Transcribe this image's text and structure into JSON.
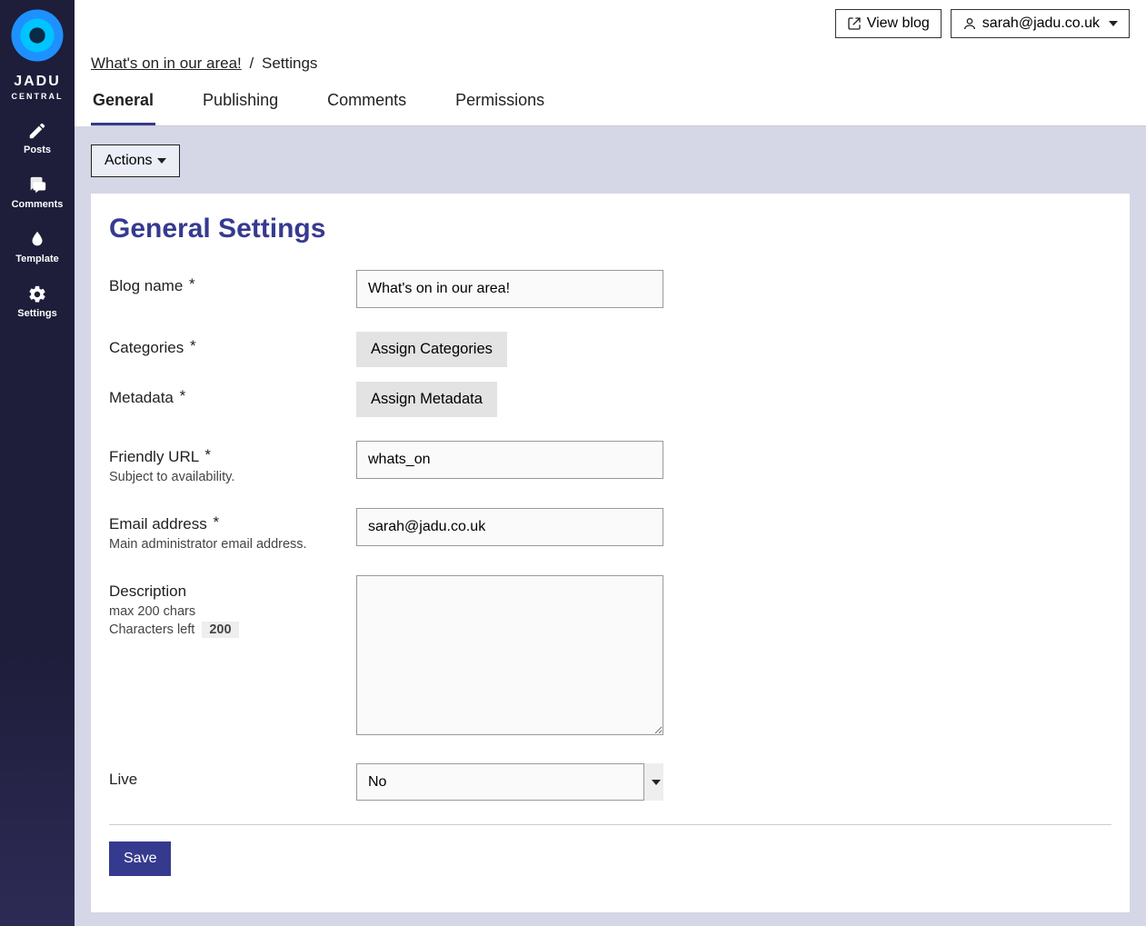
{
  "brand": {
    "main": "JADU",
    "sub": "CENTRAL"
  },
  "sidebar": {
    "items": [
      {
        "label": "Posts"
      },
      {
        "label": "Comments"
      },
      {
        "label": "Template"
      },
      {
        "label": "Settings"
      }
    ]
  },
  "topbar": {
    "view_blog": "View blog",
    "user_email": "sarah@jadu.co.uk"
  },
  "breadcrumb": {
    "link": "What's on in our area!",
    "sep": "/",
    "current": "Settings"
  },
  "tabs": [
    {
      "label": "General",
      "active": true
    },
    {
      "label": "Publishing"
    },
    {
      "label": "Comments"
    },
    {
      "label": "Permissions"
    }
  ],
  "actions_label": "Actions",
  "panel_title": "General Settings",
  "form": {
    "blog_name": {
      "label": "Blog name",
      "value": "What's on in our area!"
    },
    "categories": {
      "label": "Categories",
      "button": "Assign Categories"
    },
    "metadata": {
      "label": "Metadata",
      "button": "Assign Metadata"
    },
    "friendly_url": {
      "label": "Friendly URL",
      "help": "Subject to availability.",
      "value": "whats_on"
    },
    "email": {
      "label": "Email address",
      "help": "Main administrator email address.",
      "value": "sarah@jadu.co.uk"
    },
    "description": {
      "label": "Description",
      "help1": "max 200 chars",
      "help2_prefix": "Characters left",
      "chars_left": "200",
      "value": ""
    },
    "live": {
      "label": "Live",
      "value": "No"
    }
  },
  "save_label": "Save",
  "required_marker": "*"
}
